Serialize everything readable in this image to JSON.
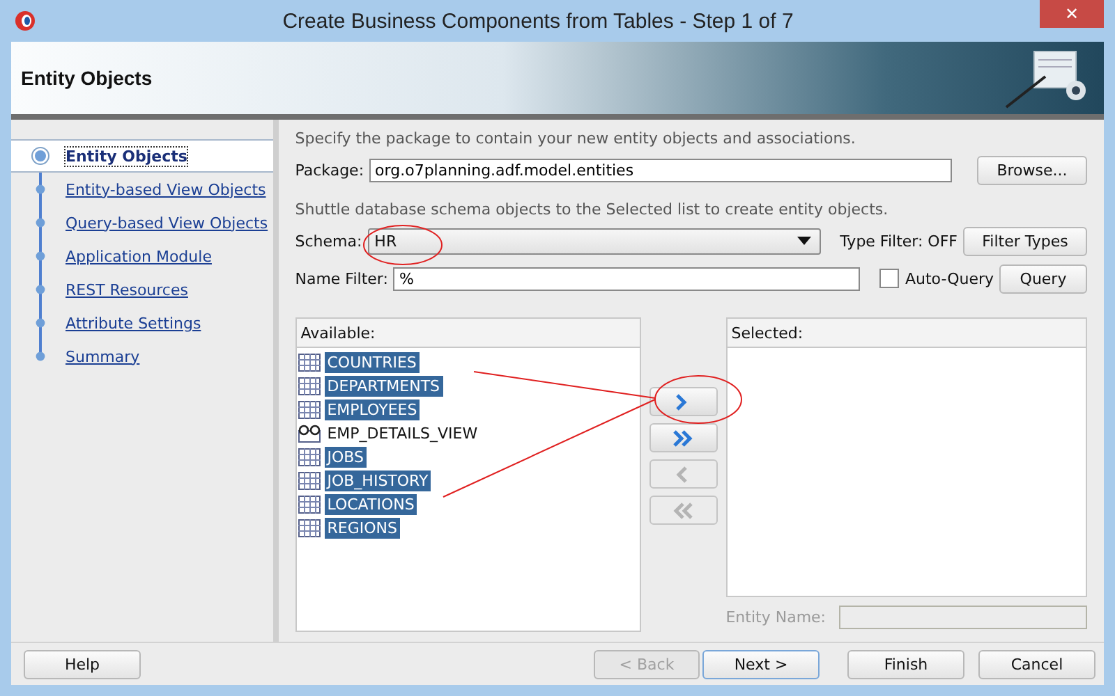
{
  "window": {
    "title": "Create Business Components from Tables - Step 1 of 7",
    "close_glyph": "✕"
  },
  "header": {
    "title": "Entity Objects"
  },
  "nav": {
    "items": [
      {
        "label": "Entity Objects",
        "selected": true
      },
      {
        "label": "Entity-based View Objects",
        "selected": false
      },
      {
        "label": "Query-based View Objects",
        "selected": false
      },
      {
        "label": "Application Module",
        "selected": false
      },
      {
        "label": "REST Resources",
        "selected": false
      },
      {
        "label": "Attribute Settings",
        "selected": false
      },
      {
        "label": "Summary",
        "selected": false
      }
    ]
  },
  "instructions": "Specify the package to contain your new entity objects and associations.",
  "package": {
    "label": "Package:",
    "value": "org.o7planning.adf.model.entities",
    "button": "Browse..."
  },
  "hint": "Shuttle database schema objects to the Selected list to create entity objects.",
  "schema": {
    "label": "Schema:",
    "value": "HR"
  },
  "type_filter": {
    "text": "Type Filter: OFF",
    "button": "Filter Types"
  },
  "name_filter": {
    "label": "Name Filter:",
    "value": "%"
  },
  "auto_query": {
    "label": "Auto-Query",
    "checked": false
  },
  "query_button": "Query",
  "available": {
    "title": "Available:",
    "items": [
      {
        "name": "COUNTRIES",
        "kind": "table",
        "selected": true
      },
      {
        "name": "DEPARTMENTS",
        "kind": "table",
        "selected": true
      },
      {
        "name": "EMPLOYEES",
        "kind": "table",
        "selected": true
      },
      {
        "name": "EMP_DETAILS_VIEW",
        "kind": "view",
        "selected": false
      },
      {
        "name": "JOBS",
        "kind": "table",
        "selected": true
      },
      {
        "name": "JOB_HISTORY",
        "kind": "table",
        "selected": true
      },
      {
        "name": "LOCATIONS",
        "kind": "table",
        "selected": true
      },
      {
        "name": "REGIONS",
        "kind": "table",
        "selected": true
      }
    ]
  },
  "shuttle": [
    {
      "kind": "move",
      "disabled": false
    },
    {
      "kind": "move_all",
      "disabled": false
    },
    {
      "kind": "remove",
      "disabled": true
    },
    {
      "kind": "remove_all",
      "disabled": true
    }
  ],
  "selected": {
    "title": "Selected:"
  },
  "entity_name": {
    "label": "Entity Name:",
    "disabled": true
  },
  "footer": {
    "buttons": [
      {
        "label": "Help",
        "disabled": false,
        "default": false
      },
      {
        "label": "< Back",
        "disabled": true,
        "default": false
      },
      {
        "label": "Next >",
        "disabled": false,
        "default": true
      },
      {
        "label": "Finish",
        "disabled": false,
        "default": false
      },
      {
        "label": "Cancel",
        "disabled": false,
        "default": false
      }
    ]
  }
}
